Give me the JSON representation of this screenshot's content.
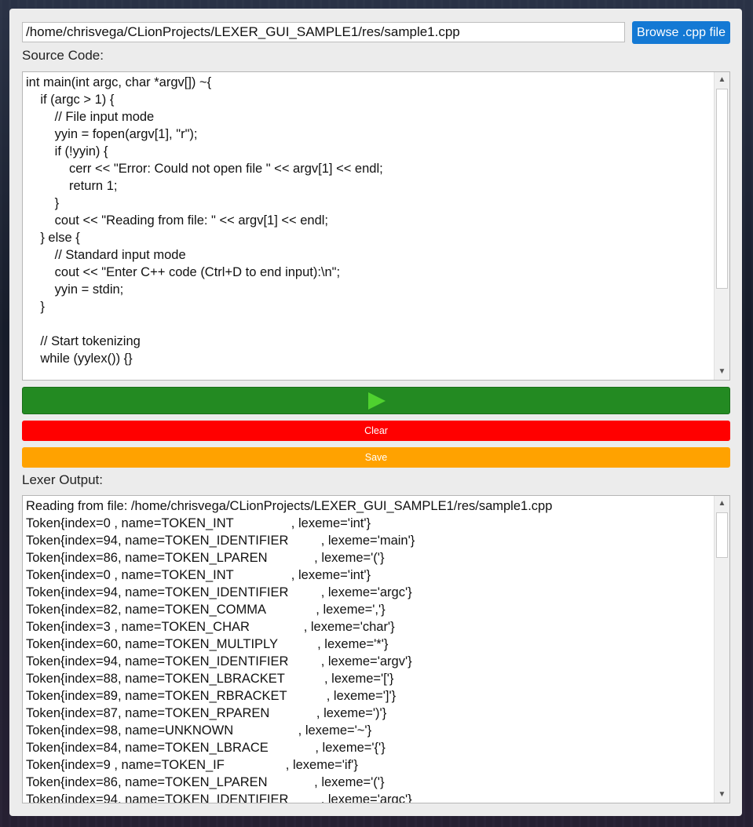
{
  "file": {
    "path": "/home/chrisvega/CLionProjects/LEXER_GUI_SAMPLE1/res/sample1.cpp",
    "browse_label": "Browse .cpp file"
  },
  "source": {
    "label": "Source Code:",
    "code": "int main(int argc, char *argv[]) ~{\n    if (argc > 1) {\n        // File input mode\n        yyin = fopen(argv[1], \"r\");\n        if (!yyin) {\n            cerr << \"Error: Could not open file \" << argv[1] << endl;\n            return 1;\n        }\n        cout << \"Reading from file: \" << argv[1] << endl;\n    } else {\n        // Standard input mode\n        cout << \"Enter C++ code (Ctrl+D to end input):\\n\";\n        yyin = stdin;\n    }\n\n    // Start tokenizing\n    while (yylex()) {}"
  },
  "actions": {
    "run_icon": "play-icon",
    "clear_label": "Clear",
    "save_label": "Save"
  },
  "output": {
    "label": "Lexer Output:",
    "text": "Reading from file: /home/chrisvega/CLionProjects/LEXER_GUI_SAMPLE1/res/sample1.cpp\nToken{index=0 , name=TOKEN_INT                , lexeme='int'}\nToken{index=94, name=TOKEN_IDENTIFIER         , lexeme='main'}\nToken{index=86, name=TOKEN_LPAREN             , lexeme='('}\nToken{index=0 , name=TOKEN_INT                , lexeme='int'}\nToken{index=94, name=TOKEN_IDENTIFIER         , lexeme='argc'}\nToken{index=82, name=TOKEN_COMMA              , lexeme=','}\nToken{index=3 , name=TOKEN_CHAR               , lexeme='char'}\nToken{index=60, name=TOKEN_MULTIPLY           , lexeme='*'}\nToken{index=94, name=TOKEN_IDENTIFIER         , lexeme='argv'}\nToken{index=88, name=TOKEN_LBRACKET           , lexeme='['}\nToken{index=89, name=TOKEN_RBRACKET           , lexeme=']'}\nToken{index=87, name=TOKEN_RPAREN             , lexeme=')'}\nToken{index=98, name=UNKNOWN                  , lexeme='~'}\nToken{index=84, name=TOKEN_LBRACE             , lexeme='{'}\nToken{index=9 , name=TOKEN_IF                 , lexeme='if'}\nToken{index=86, name=TOKEN_LPAREN             , lexeme='('}\nToken{index=94, name=TOKEN_IDENTIFIER         , lexeme='argc'}"
  },
  "colors": {
    "browse": "#1479d4",
    "run": "#238a22",
    "run_icon": "#4fd12f",
    "clear": "#ff0000",
    "save": "#ffa200"
  }
}
